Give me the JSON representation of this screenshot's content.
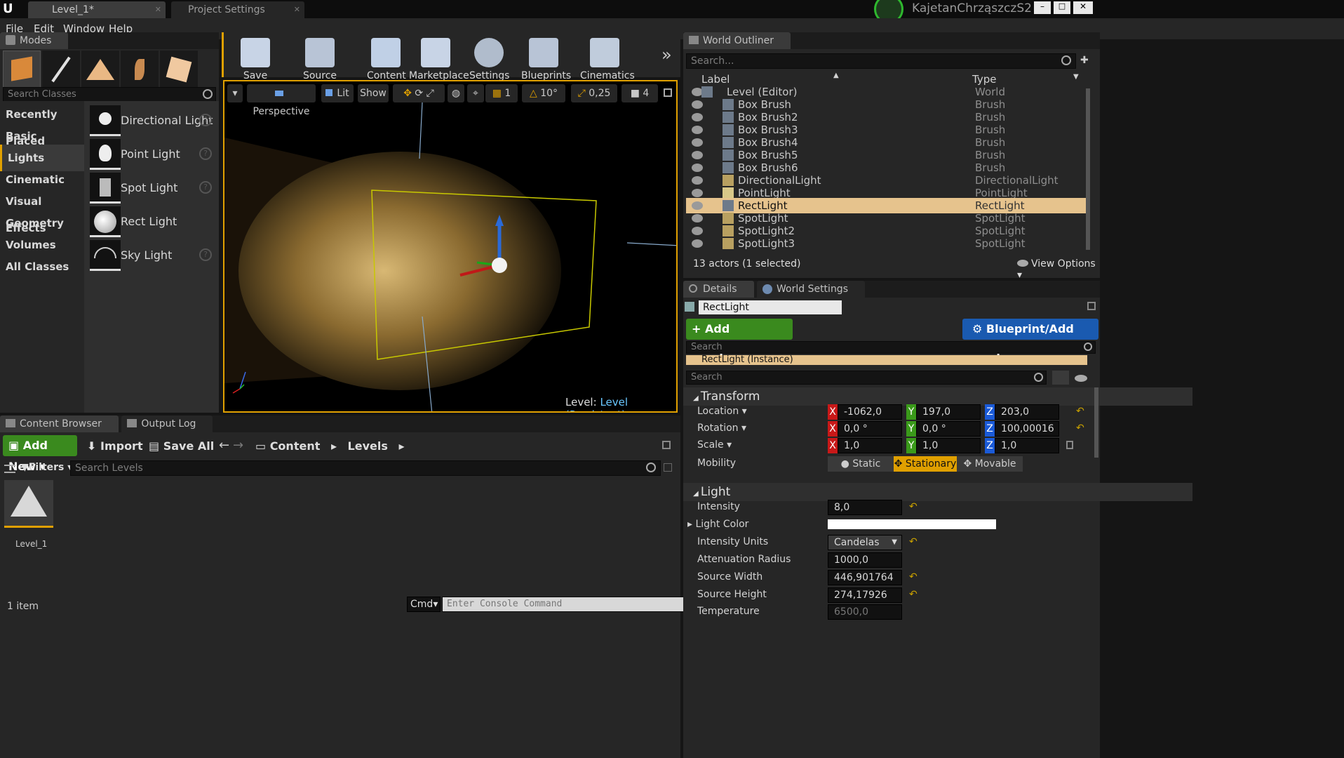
{
  "tabs": [
    "Level_1*",
    "Project Settings"
  ],
  "user": "KajetanChrząszczS2",
  "menu": [
    "File",
    "Edit",
    "Window",
    "Help"
  ],
  "modes": {
    "title": "Modes",
    "search_placeholder": "Search Classes",
    "categories": [
      "Recently Placed",
      "Basic",
      "Lights",
      "Cinematic",
      "Visual Effects",
      "Geometry",
      "Volumes",
      "All Classes"
    ],
    "selected": "Lights",
    "items": [
      "Directional Light",
      "Point Light",
      "Spot Light",
      "Rect Light",
      "Sky Light"
    ]
  },
  "toolbar": [
    "Save Current",
    "Source Control",
    "Content",
    "Marketplace",
    "Settings",
    "Blueprints",
    "Cinematics"
  ],
  "viewport": {
    "perspective": "Perspective",
    "lit": "Lit",
    "show": "Show",
    "grid": "1",
    "angle": "10°",
    "scale": "0,25",
    "cam_speed": "4",
    "level_label": "Level:",
    "level_name": "Level (Persistent)"
  },
  "outliner": {
    "title": "World Outliner",
    "search_placeholder": "Search...",
    "col_label": "Label",
    "col_type": "Type",
    "rows": [
      {
        "label": "Level (Editor)",
        "type": "World"
      },
      {
        "label": "Box Brush",
        "type": "Brush"
      },
      {
        "label": "Box Brush2",
        "type": "Brush"
      },
      {
        "label": "Box Brush3",
        "type": "Brush"
      },
      {
        "label": "Box Brush4",
        "type": "Brush"
      },
      {
        "label": "Box Brush5",
        "type": "Brush"
      },
      {
        "label": "Box Brush6",
        "type": "Brush"
      },
      {
        "label": "DirectionalLight",
        "type": "DirectionalLight"
      },
      {
        "label": "PointLight",
        "type": "PointLight"
      },
      {
        "label": "RectLight",
        "type": "RectLight"
      },
      {
        "label": "SpotLight",
        "type": "SpotLight"
      },
      {
        "label": "SpotLight2",
        "type": "SpotLight"
      },
      {
        "label": "SpotLight3",
        "type": "SpotLight"
      }
    ],
    "status": "13 actors (1 selected)",
    "view_options": "View Options"
  },
  "details": {
    "tab_details": "Details",
    "tab_world": "World Settings",
    "name": "RectLight",
    "add_component": "+ Add Component",
    "blueprint": "Blueprint/Add Script",
    "search1": "Search",
    "instance": "RectLight (Instance)",
    "search2": "Search",
    "transform": "Transform",
    "location_lbl": "Location",
    "rotation_lbl": "Rotation",
    "scale_lbl": "Scale",
    "mobility_lbl": "Mobility",
    "location": [
      "-1062,0",
      "197,0",
      "203,0"
    ],
    "rotation": [
      "0,0 °",
      "0,0 °",
      "100,00016 °"
    ],
    "scale": [
      "1,0",
      "1,0",
      "1,0"
    ],
    "mobility": [
      "Static",
      "Stationary",
      "Movable"
    ],
    "light": "Light",
    "intensity_lbl": "Intensity",
    "intensity": "8,0",
    "color_lbl": "Light Color",
    "units_lbl": "Intensity Units",
    "units": "Candelas",
    "atten_lbl": "Attenuation Radius",
    "atten": "1000,0",
    "sw_lbl": "Source Width",
    "sw": "446,901764",
    "sh_lbl": "Source Height",
    "sh": "274,17926",
    "temp_lbl": "Temperature",
    "temp": "6500,0"
  },
  "content_browser": {
    "tab1": "Content Browser",
    "tab2": "Output Log",
    "add_new": "Add New",
    "import": "Import",
    "save_all": "Save All",
    "path": [
      "Content",
      "Levels"
    ],
    "filters": "Filters",
    "search_placeholder": "Search Levels",
    "asset": "Level_1",
    "count": "1 item"
  },
  "console": {
    "cmd": "Cmd",
    "placeholder": "Enter Console Command"
  }
}
